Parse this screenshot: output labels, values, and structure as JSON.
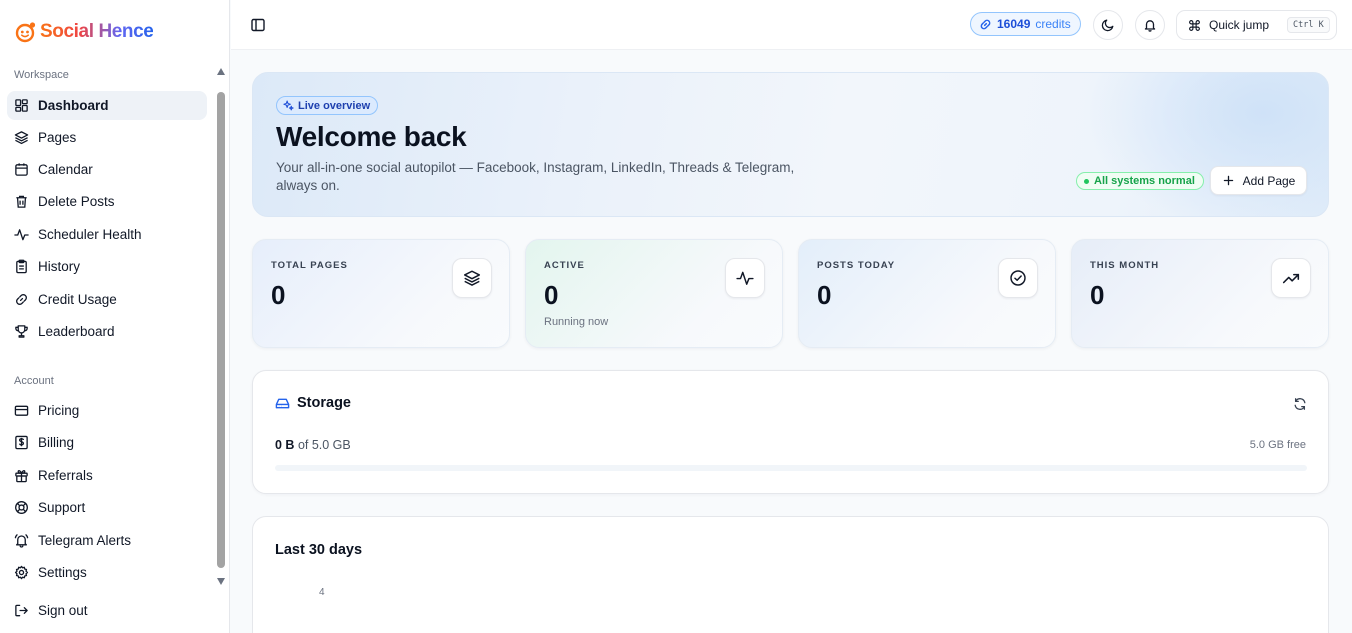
{
  "brand": {
    "name": "Social Hence"
  },
  "sidebar": {
    "workspace_label": "Workspace",
    "account_label": "Account",
    "workspace_items": [
      {
        "label": "Dashboard",
        "icon": "dashboard-icon",
        "active": true
      },
      {
        "label": "Pages",
        "icon": "layers-icon"
      },
      {
        "label": "Calendar",
        "icon": "calendar-icon"
      },
      {
        "label": "Delete Posts",
        "icon": "trash-icon"
      },
      {
        "label": "Scheduler Health",
        "icon": "activity-icon"
      },
      {
        "label": "History",
        "icon": "clipboard-icon"
      },
      {
        "label": "Credit Usage",
        "icon": "link-icon"
      },
      {
        "label": "Leaderboard",
        "icon": "trophy-icon"
      }
    ],
    "account_items": [
      {
        "label": "Pricing",
        "icon": "credit-card-icon"
      },
      {
        "label": "Billing",
        "icon": "dollar-icon"
      },
      {
        "label": "Referrals",
        "icon": "gift-icon"
      },
      {
        "label": "Support",
        "icon": "lifebuoy-icon"
      },
      {
        "label": "Telegram Alerts",
        "icon": "bell-ring-icon"
      },
      {
        "label": "Settings",
        "icon": "gear-icon"
      }
    ],
    "signout_label": "Sign out"
  },
  "topbar": {
    "credits_value": "16049",
    "credits_label": "credits",
    "quick_jump_label": "Quick jump",
    "quick_jump_shortcut": "Ctrl K"
  },
  "hero": {
    "badge": "Live overview",
    "title": "Welcome back",
    "subtitle": "Your all-in-one social autopilot — Facebook, Instagram, LinkedIn, Threads & Telegram, always on.",
    "status": "All systems normal",
    "add_page_label": "Add Page"
  },
  "stats": [
    {
      "label": "TOTAL PAGES",
      "value": "0",
      "sub": "",
      "icon": "layers-icon",
      "bg": "#e6eefb"
    },
    {
      "label": "ACTIVE",
      "value": "0",
      "sub": "Running now",
      "icon": "activity-icon",
      "bg": "#e3f5ee"
    },
    {
      "label": "POSTS TODAY",
      "value": "0",
      "sub": "",
      "icon": "check-circle-icon",
      "bg": "#e3eefa"
    },
    {
      "label": "THIS MONTH",
      "value": "0",
      "sub": "",
      "icon": "trending-up-icon",
      "bg": "#e6edf8"
    }
  ],
  "storage": {
    "title": "Storage",
    "used": "0 B",
    "of_text": "of 5.0 GB",
    "free": "5.0 GB free",
    "used_fraction": 0
  },
  "chart": {
    "title": "Last 30 days",
    "y_ticks": [
      "4"
    ]
  },
  "colors": {
    "accent": "#2563eb",
    "success": "#16a34a"
  }
}
